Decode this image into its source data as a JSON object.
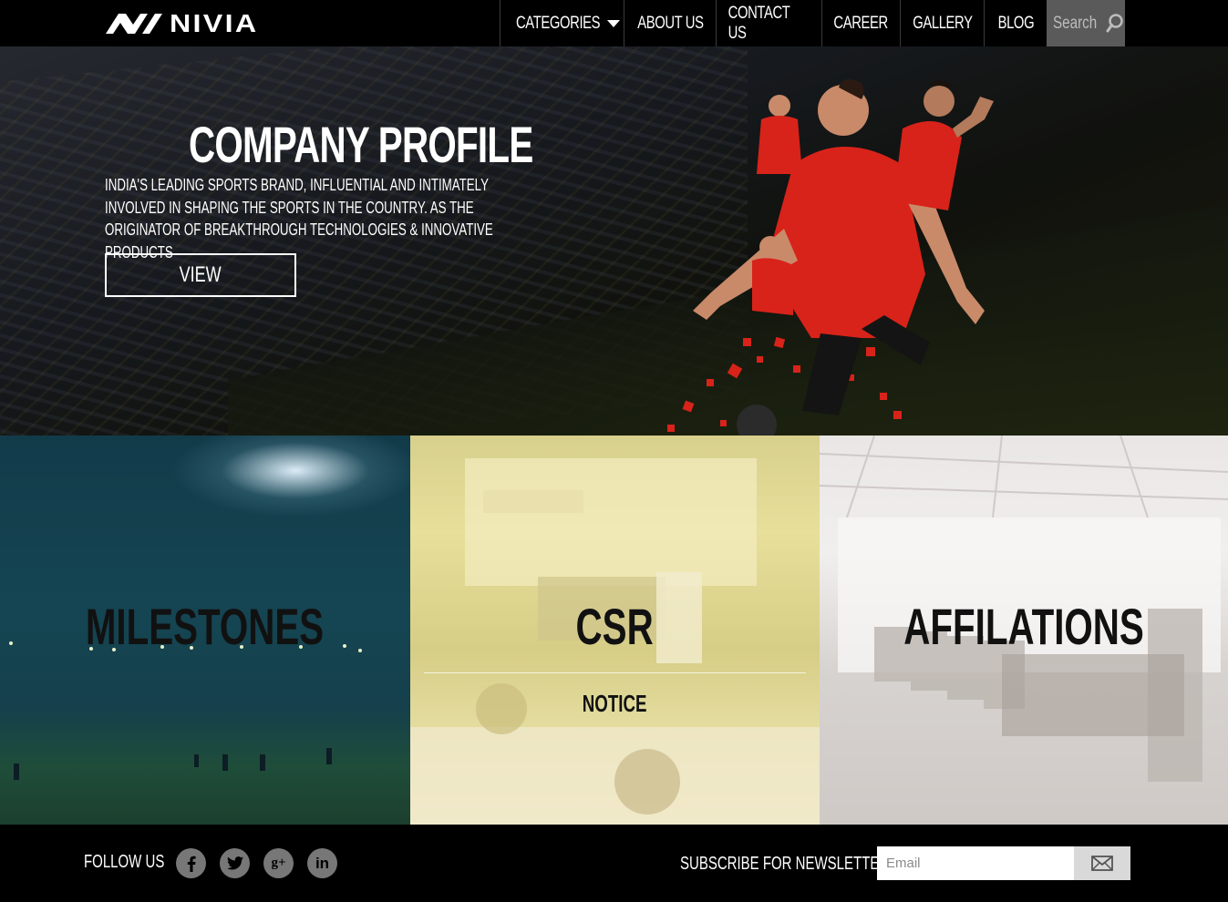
{
  "brand": {
    "name": "NIVIA"
  },
  "nav": {
    "items": [
      {
        "label": "CATEGORIES",
        "has_dropdown": true
      },
      {
        "label": "ABOUT US"
      },
      {
        "label": "CONTACT US"
      },
      {
        "label": "CAREER"
      },
      {
        "label": "GALLERY"
      },
      {
        "label": "BLOG"
      }
    ],
    "search_label": "Search",
    "search_icon": "search-icon"
  },
  "hero": {
    "title": "COMPANY PROFILE",
    "description": "INDIA'S LEADING SPORTS BRAND, INFLUENTIAL AND INTIMATELY INVOLVED IN SHAPING THE SPORTS IN THE COUNTRY. AS THE ORIGINATOR OF BREAKTHROUGH TECHNOLOGIES & INNOVATIVE PRODUCTS",
    "button_label": "VIEW"
  },
  "tiles": [
    {
      "label": "MILESTONES"
    },
    {
      "label": "CSR",
      "sublabel": "NOTICE"
    },
    {
      "label": "AFFILATIONS"
    }
  ],
  "footer": {
    "follow_label": "FOLLOW US",
    "socials": [
      "facebook-icon",
      "twitter-icon",
      "google-plus-icon",
      "linkedin-icon"
    ],
    "subscribe_label": "SUBSCRIBE FOR NEWSLETTER",
    "email_placeholder": "Email",
    "submit_icon": "envelope-icon"
  },
  "colors": {
    "nav_bg": "#000000",
    "search_bg": "#5a5a5a",
    "accent_red": "#e0251b",
    "tile_milestones": "#154553",
    "tile_csr": "#e7df9a",
    "tile_affilations": "#efedec"
  }
}
